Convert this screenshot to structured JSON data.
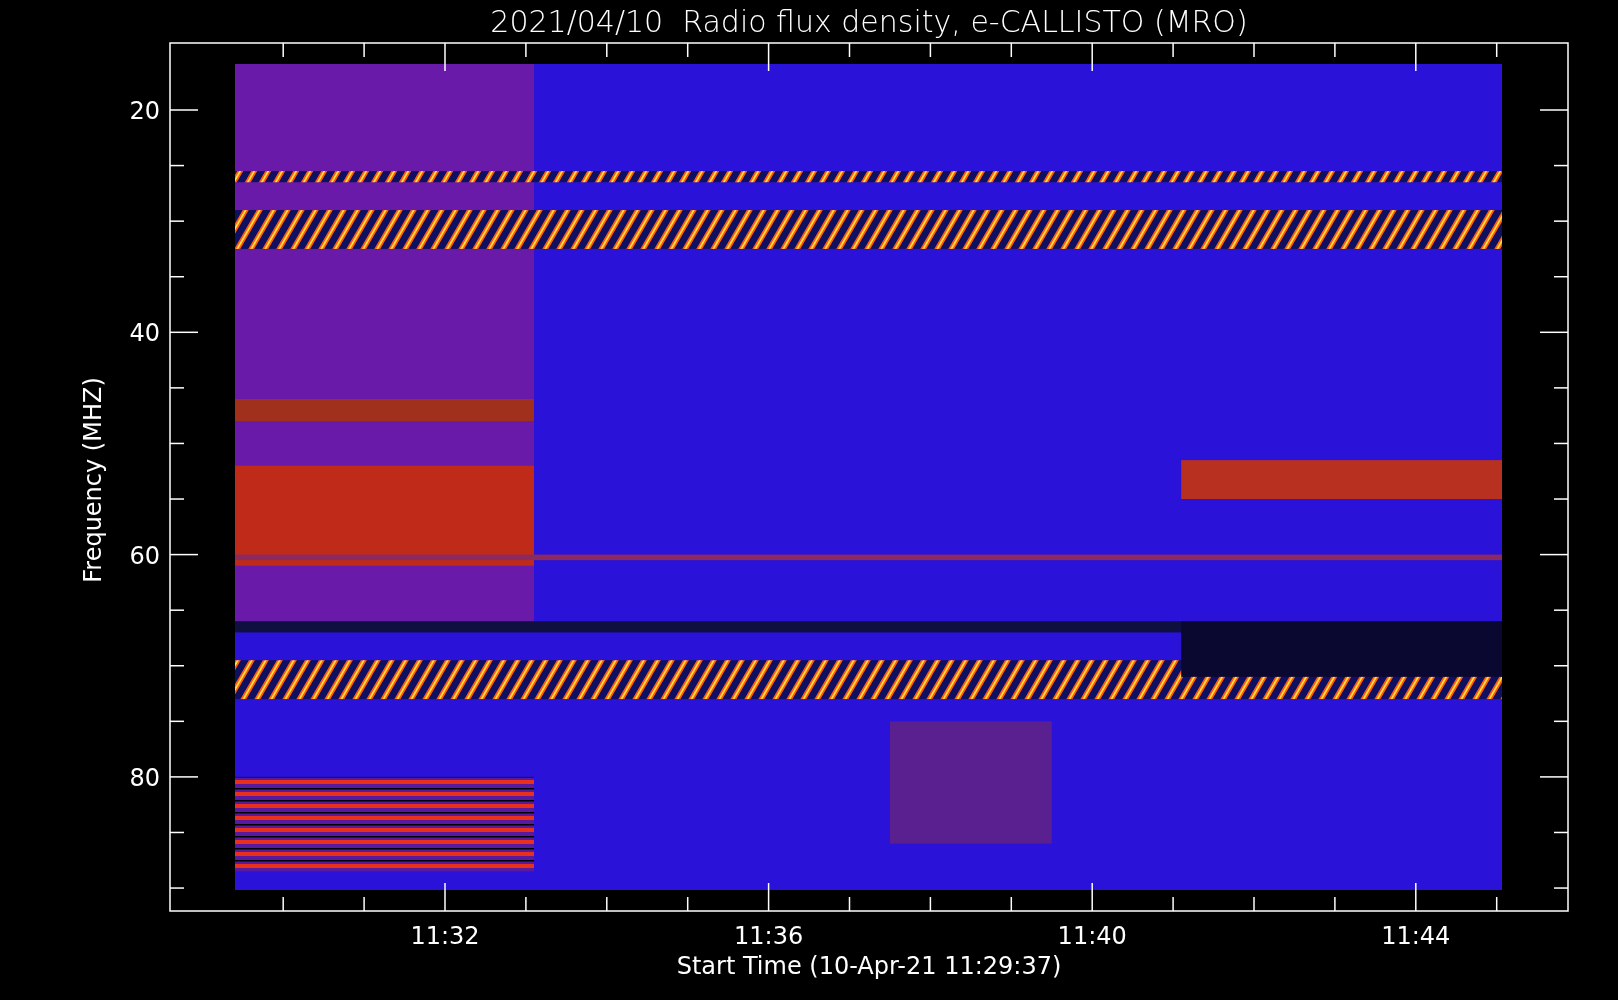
{
  "chart": {
    "kind": "spectrogram",
    "title": "2021/04/10  Radio flux density, e-CALLISTO (MRO)",
    "ylabel": "Frequency (MHZ)",
    "xlabel": "Start Time (10-Apr-21 11:29:37)",
    "yticks": [
      "20",
      "40",
      "60",
      "80"
    ],
    "xticks": [
      "11:32",
      "11:36",
      "11:40",
      "11:44"
    ]
  }
}
